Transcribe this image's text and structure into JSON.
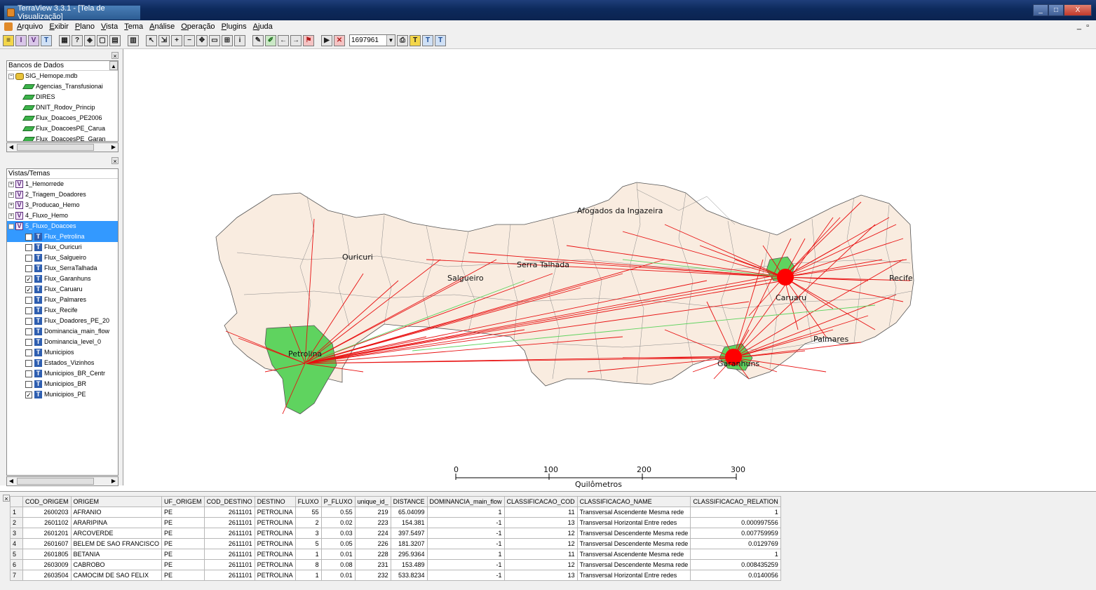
{
  "window": {
    "title": "TerraView 3.3.1 - [Tela de Visualização]",
    "controls": [
      "_",
      "□",
      "X"
    ]
  },
  "menu": {
    "items": [
      "Arquivo",
      "Exibir",
      "Plano",
      "Vista",
      "Tema",
      "Análise",
      "Operação",
      "Plugins",
      "Ajuda"
    ],
    "mdi": "_ ▫"
  },
  "toolbar": {
    "scale": "1697961"
  },
  "databases": {
    "header": "Bancos de Dados",
    "root": "SIG_Hemope.mdb",
    "layers": [
      "Agencias_Transfusionai",
      "DIRES",
      "DNIT_Rodov_Princip",
      "Flux_Doacoes_PE2006",
      "Flux_DoacoesPE_Carua",
      "Flux_DoacoesPE_Garan"
    ]
  },
  "views": {
    "header": "Vistas/Temas",
    "items": [
      "1_Hemorrede",
      "2_Triagem_Doadores",
      "3_Producao_Hemo",
      "4_Fluxo_Hemo",
      "5_Fluxo_Doacoes"
    ],
    "themes": [
      {
        "name": "Flux_Petrolina",
        "checked": true,
        "selected": true
      },
      {
        "name": "Flux_Ouricuri",
        "checked": false
      },
      {
        "name": "Flux_Salgueiro",
        "checked": false
      },
      {
        "name": "Flux_SerraTalhada",
        "checked": false
      },
      {
        "name": "Flux_Garanhuns",
        "checked": true
      },
      {
        "name": "Flux_Caruaru",
        "checked": true
      },
      {
        "name": "Flux_Palmares",
        "checked": false
      },
      {
        "name": "Flux_Recife",
        "checked": false
      },
      {
        "name": "Flux_Doadores_PE_20",
        "checked": false
      },
      {
        "name": "Dominancia_main_flow",
        "checked": false
      },
      {
        "name": "Dominancia_level_0",
        "checked": false
      },
      {
        "name": "Municipios",
        "checked": false
      },
      {
        "name": "Estados_Vizinhos",
        "checked": false
      },
      {
        "name": "Municipios_BR_Centr",
        "checked": false
      },
      {
        "name": "Municipios_BR",
        "checked": false
      },
      {
        "name": "Municipios_PE",
        "checked": true
      }
    ]
  },
  "map": {
    "cities": [
      "Afogados da Ingazeira",
      "Ouricuri",
      "Serra Talhada",
      "Salgueiro",
      "Recife",
      "Caruaru",
      "Palmares",
      "Petrolina",
      "Garanhuns"
    ],
    "scalebar": {
      "ticks": [
        "0",
        "100",
        "200",
        "300"
      ],
      "unit": "Quilômetros"
    },
    "colors": {
      "flow": "#e81010",
      "fill": "#f9ece0",
      "highlight": "#5fd35f",
      "hub": "#ff0000"
    }
  },
  "table": {
    "columns": [
      "COD_ORIGEM",
      "ORIGEM",
      "UF_ORIGEM",
      "COD_DESTINO",
      "DESTINO",
      "FLUXO",
      "P_FLUXO",
      "unique_id_",
      "DISTANCE",
      "DOMINANCIA_main_flow",
      "CLASSIFICACAO_COD",
      "CLASSIFICACAO_NAME",
      "CLASSIFICACAO_RELATION"
    ],
    "rows": [
      [
        "1",
        "2600203",
        "AFRANIO",
        "PE",
        "2611101",
        "PETROLINA",
        "55",
        "0.55",
        "219",
        "65.04099",
        "1",
        "11",
        "Transversal Ascendente Mesma rede",
        "1"
      ],
      [
        "2",
        "2601102",
        "ARARIPINA",
        "PE",
        "2611101",
        "PETROLINA",
        "2",
        "0.02",
        "223",
        "154.381",
        "-1",
        "13",
        "Transversal Horizontal Entre redes",
        "0.000997556"
      ],
      [
        "3",
        "2601201",
        "ARCOVERDE",
        "PE",
        "2611101",
        "PETROLINA",
        "3",
        "0.03",
        "224",
        "397.5497",
        "-1",
        "12",
        "Transversal Descendente Mesma rede",
        "0.007759959"
      ],
      [
        "4",
        "2601607",
        "BELEM DE SAO FRANCISCO",
        "PE",
        "2611101",
        "PETROLINA",
        "5",
        "0.05",
        "226",
        "181.3207",
        "-1",
        "12",
        "Transversal Descendente Mesma rede",
        "0.0129769"
      ],
      [
        "5",
        "2601805",
        "BETANIA",
        "PE",
        "2611101",
        "PETROLINA",
        "1",
        "0.01",
        "228",
        "295.9364",
        "1",
        "11",
        "Transversal Ascendente Mesma rede",
        "1"
      ],
      [
        "6",
        "2603009",
        "CABROBO",
        "PE",
        "2611101",
        "PETROLINA",
        "8",
        "0.08",
        "231",
        "153.489",
        "-1",
        "12",
        "Transversal Descendente Mesma rede",
        "0.008435259"
      ],
      [
        "7",
        "2603504",
        "CAMOCIM DE SAO FELIX",
        "PE",
        "2611101",
        "PETROLINA",
        "1",
        "0.01",
        "232",
        "533.8234",
        "-1",
        "13",
        "Transversal Horizontal Entre redes",
        "0.0140056"
      ]
    ]
  }
}
